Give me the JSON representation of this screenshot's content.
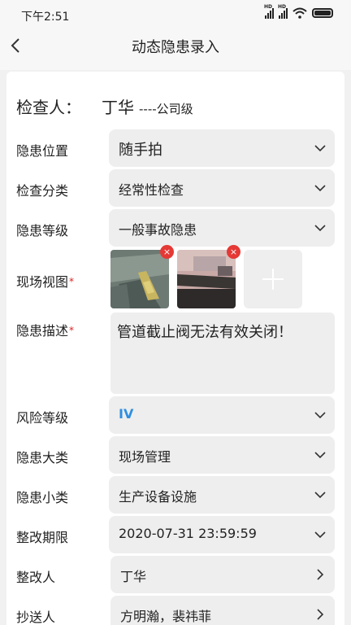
{
  "status_bar": {
    "time": "下午2:51",
    "signal_label": "HD"
  },
  "nav": {
    "title": "动态隐患录入"
  },
  "inspector": {
    "label": "检查人：",
    "name": "丁华",
    "level": "----公司级"
  },
  "form": {
    "location": {
      "label": "隐患位置",
      "value": "随手拍"
    },
    "category": {
      "label": "检查分类",
      "value": "经常性检查"
    },
    "grade": {
      "label": "隐患等级",
      "value": "一般事故隐患"
    },
    "photos": {
      "label": "现场视图",
      "required_mark": "*",
      "delete_symbol": "×"
    },
    "description": {
      "label": "隐患描述",
      "required_mark": "*",
      "value": "管道截止阀无法有效关闭！"
    },
    "risk_level": {
      "label": "风险等级",
      "value": "IV",
      "value_color": "#2f8fe0"
    },
    "major_type": {
      "label": "隐患大类",
      "value": "现场管理"
    },
    "minor_type": {
      "label": "隐患小类",
      "value": "生产设备设施"
    },
    "deadline": {
      "label": "整改期限",
      "value": "2020-07-31 23:59:59"
    },
    "rectifier": {
      "label": "整改人",
      "value": "丁华"
    },
    "cc": {
      "label": "抄送人",
      "value": "方明瀚，裴祎菲"
    }
  },
  "colors": {
    "required": "#e02020",
    "field_bg": "#eeeeee",
    "delete_badge": "#e53935"
  }
}
